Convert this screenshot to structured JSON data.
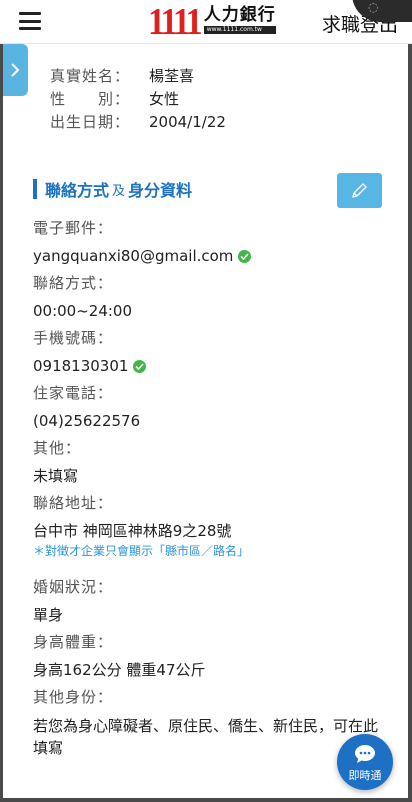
{
  "header": {
    "logo_number": "1111",
    "logo_text": "人力銀行",
    "logo_url": "www.1111.com.tw",
    "right_link": "求職登出"
  },
  "basic_info": [
    {
      "label": "真實姓名：",
      "value": "楊荃喜"
    },
    {
      "label": "性　　別：",
      "value": "女性"
    },
    {
      "label": "出生日期：",
      "value": "2004/1/22"
    }
  ],
  "section": {
    "title_part1": "聯絡方式",
    "title_and": "及",
    "title_part2": "身分資料"
  },
  "fields": {
    "email": {
      "label": "電子郵件：",
      "value": "yangquanxi80@gmail.com",
      "verified": true
    },
    "contact_time": {
      "label": "聯絡方式：",
      "value": "00:00~24:00"
    },
    "mobile": {
      "label": "手機號碼：",
      "value": "0918130301",
      "verified": true
    },
    "home_phone": {
      "label": "住家電話：",
      "value": "(04)25622576"
    },
    "other": {
      "label": "其他：",
      "value": "未填寫"
    },
    "address": {
      "label": "聯絡地址：",
      "value": "台中市 神岡區神林路9之28號",
      "note": "＊對徵才企業只會顯示「縣市區／路名」"
    },
    "marital": {
      "label": "婚姻狀況：",
      "value": "單身"
    },
    "body": {
      "label": "身高體重：",
      "value": "身高162公分 體重47公斤"
    },
    "identity": {
      "label": "其他身份：",
      "value": "若您為身心障礙者、原住民、僑生、新住民，可在此填寫"
    }
  },
  "chat": {
    "label": "即時通"
  },
  "colors": {
    "accent": "#1d72c2",
    "edit_button": "#58b6e5",
    "verified": "#43b649",
    "note": "#2f95d8",
    "logo_red": "#e02020"
  },
  "icons": {
    "menu": "hamburger-icon",
    "side": "chevron-right-icon",
    "edit": "pencil-icon",
    "verified": "check-circle-icon",
    "chat": "chat-bubble-icon"
  }
}
